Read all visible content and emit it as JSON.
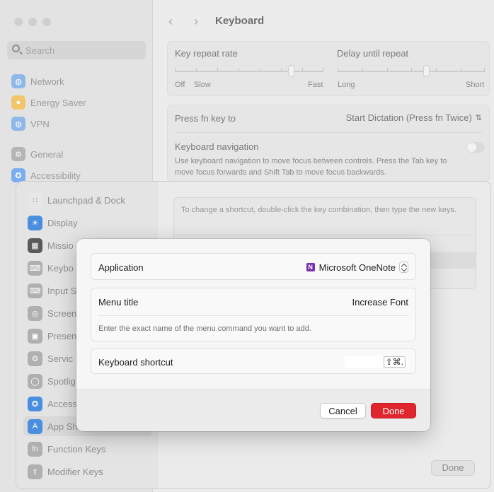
{
  "window": {
    "title": "Keyboard",
    "search_placeholder": "Search"
  },
  "sidebar": {
    "items": [
      {
        "label": "Network",
        "icon": "globe-icon",
        "color": "#8fb8e8"
      },
      {
        "label": "Energy Saver",
        "icon": "lightbulb-icon",
        "color": "#f3c56a"
      },
      {
        "label": "VPN",
        "icon": "globe-icon",
        "color": "#8fb8e8"
      },
      {
        "label": "General",
        "icon": "gear-icon",
        "color": "#b5b5b5"
      },
      {
        "label": "Accessibility",
        "icon": "accessibility-icon",
        "color": "#7aaef0"
      }
    ]
  },
  "keyboard": {
    "key_repeat_label": "Key repeat rate",
    "key_repeat_ticks": [
      "Off",
      "Slow",
      "Fast"
    ],
    "key_repeat_level": 0.78,
    "delay_label": "Delay until repeat",
    "delay_ticks": [
      "Long",
      "Short"
    ],
    "delay_level": 0.6,
    "fn_label": "Press fn key to",
    "fn_value": "Start Dictation (Press fn Twice)",
    "nav_label": "Keyboard navigation",
    "nav_desc": "Use keyboard navigation to move focus between controls. Press the Tab key to move focus forwards and Shift Tab to move focus backwards.",
    "nav_on": false
  },
  "shortcuts_sheet": {
    "items": [
      {
        "label": "Launchpad & Dock",
        "icon": "launchpad-icon",
        "color": "#e7e7e7"
      },
      {
        "label": "Display",
        "icon": "sun-icon",
        "color": "#4a8ee0"
      },
      {
        "label": "Missio",
        "icon": "mission-control-icon",
        "color": "#5a5a5a"
      },
      {
        "label": "Keybo",
        "icon": "keyboard-icon",
        "color": "#b0b0b0"
      },
      {
        "label": "Input S",
        "icon": "keyboard-icon",
        "color": "#b0b0b0"
      },
      {
        "label": "Screen",
        "icon": "screenshot-icon",
        "color": "#b0b0b0"
      },
      {
        "label": "Presen",
        "icon": "presenter-icon",
        "color": "#b0b0b0"
      },
      {
        "label": "Servic",
        "icon": "gear-icon",
        "color": "#b0b0b0"
      },
      {
        "label": "Spotlig",
        "icon": "search-icon",
        "color": "#b0b0b0"
      },
      {
        "label": "Access",
        "icon": "accessibility-icon",
        "color": "#4a8ee0"
      },
      {
        "label": "App Sh",
        "icon": "app-store-icon",
        "color": "#4a8ee0"
      },
      {
        "label": "Function Keys",
        "icon": "fn-icon",
        "color": "#b0b0b0"
      },
      {
        "label": "Modifier Keys",
        "icon": "arrow-up-icon",
        "color": "#b0b0b0"
      }
    ],
    "info_text": "To change a shortcut, double-click the key combination, then type the new keys.",
    "done_label": "Done"
  },
  "dialog": {
    "application_label": "Application",
    "application_value": "Microsoft OneNote",
    "menu_title_label": "Menu title",
    "menu_title_value": "Increase Font",
    "menu_hint": "Enter the exact name of the menu command you want to add.",
    "shortcut_label": "Keyboard shortcut",
    "shortcut_value": "⇧⌘.",
    "cancel_label": "Cancel",
    "done_label": "Done",
    "accent_color": "#e0252f"
  }
}
